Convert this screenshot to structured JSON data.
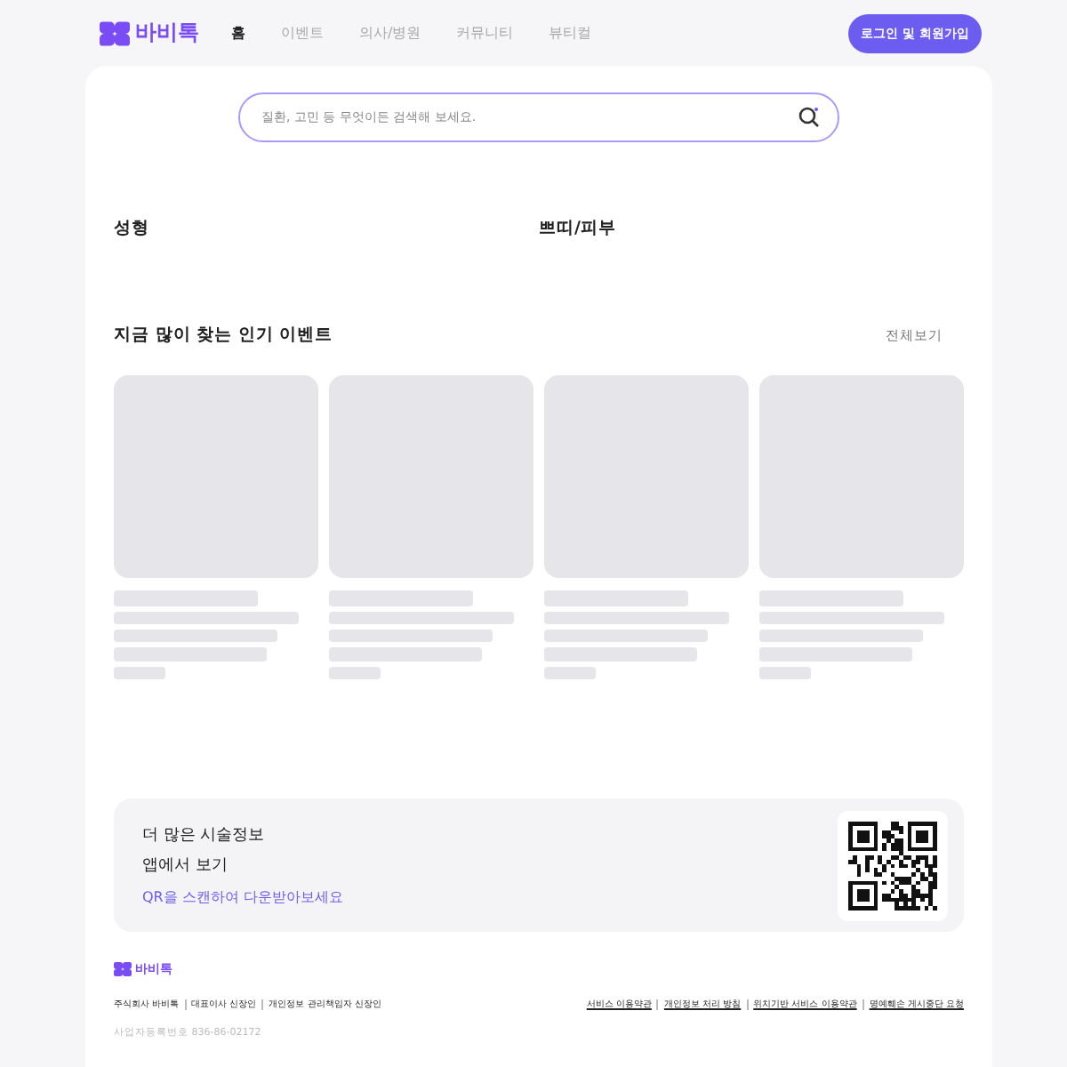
{
  "header": {
    "logo": "바비톡",
    "nav": [
      {
        "label": "홈",
        "selected": true
      },
      {
        "label": "이벤트",
        "selected": false
      },
      {
        "label": "의사/병원",
        "selected": false
      },
      {
        "label": "커뮤니티",
        "selected": false
      },
      {
        "label": "뷰티컬",
        "selected": false
      }
    ],
    "login_button": "로그인 및 회원가입"
  },
  "search": {
    "placeholder": "질환, 고민 등 무엇이든 검색해 보세요."
  },
  "categories": [
    "성형",
    "쁘띠/피부"
  ],
  "popular_events": {
    "title": "지금 많이 찾는 인기 이벤트",
    "view_all": "전체보기",
    "cards": [
      {
        "kind": "skeleton"
      },
      {
        "kind": "skeleton"
      },
      {
        "kind": "skeleton"
      },
      {
        "kind": "skeleton"
      }
    ]
  },
  "app_promo": {
    "title_lines": [
      "더 많은 시술정보",
      "앱에서 보기"
    ],
    "cta": "QR을 스캔하여 다운받아보세요"
  },
  "footer": {
    "logo": "바비톡",
    "company_info": [
      "주식회사 바비톡",
      "대표이사 신장인",
      "개인정보 관리책임자 신장인"
    ],
    "links": [
      "서비스 이용약관",
      "개인정보 처리 방침",
      "위치기반 서비스 이용약관",
      "명예훼손 게시중단 요청"
    ],
    "registration": "사업자등록번호 836-86-02172"
  }
}
